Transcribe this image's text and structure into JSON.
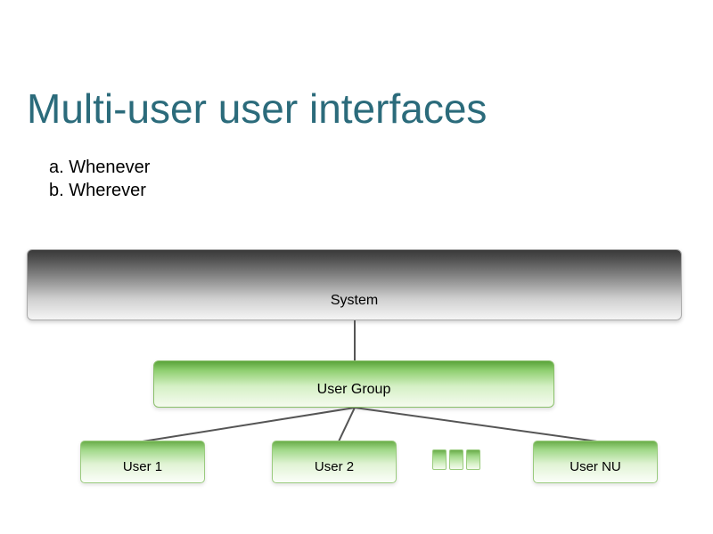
{
  "title": "Multi-user user interfaces",
  "subtext": {
    "line_a": "a. Whenever",
    "line_b": "b. Wherever"
  },
  "diagram": {
    "system_label": "System",
    "group_label": "User Group",
    "users": {
      "u1": "User 1",
      "u2": "User 2",
      "un": "User NU"
    }
  }
}
